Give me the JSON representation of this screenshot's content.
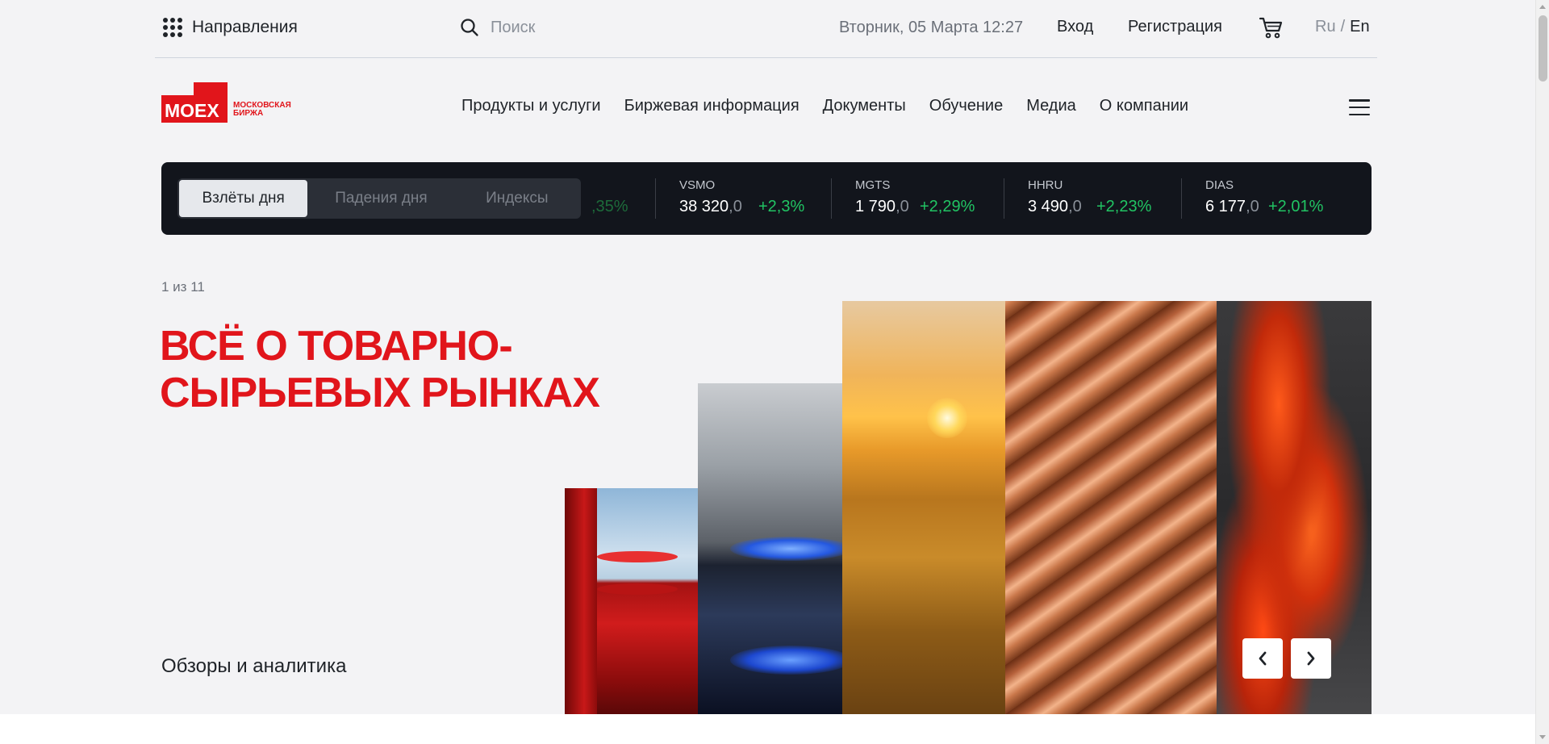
{
  "topbar": {
    "directions_label": "Направления",
    "search_placeholder": "Поиск",
    "datetime": "Вторник, 05 Марта 12:27",
    "login_label": "Вход",
    "register_label": "Регистрация",
    "lang_ru": "Ru",
    "lang_sep": "/",
    "lang_en": "En"
  },
  "brand": {
    "logo_text": "MOEX",
    "logo_sub_line1": "МОСКОВСКАЯ",
    "logo_sub_line2": "БИРЖА",
    "accent_color": "#e1151b"
  },
  "nav": {
    "items": [
      "Продукты и услуги",
      "Биржевая информация",
      "Документы",
      "Обучение",
      "Медиа",
      "О компании"
    ]
  },
  "ticker": {
    "tabs": [
      "Взлёты дня",
      "Падения дня",
      "Индексы"
    ],
    "active_tab": "Взлёты дня",
    "partial_change": ",35%",
    "items": [
      {
        "name": "VSMO",
        "price": "38 320",
        "price_dec": ",0",
        "change": "+2,3%"
      },
      {
        "name": "MGTS",
        "price": "1 790",
        "price_dec": ",0",
        "change": "+2,29%"
      },
      {
        "name": "HHRU",
        "price": "3 490",
        "price_dec": ",0",
        "change": "+2,23%"
      },
      {
        "name": "DIAS",
        "price": "6 177",
        "price_dec": ",0",
        "change": "+2,01%"
      }
    ],
    "up_color": "#21c463"
  },
  "hero": {
    "counter": "1 из 11",
    "headline_line1": "ВСЁ О ТОВАРНО-",
    "headline_line2": "СЫРЬЕВЫХ РЫНКАХ",
    "section_label": "Обзоры и аналитика"
  }
}
